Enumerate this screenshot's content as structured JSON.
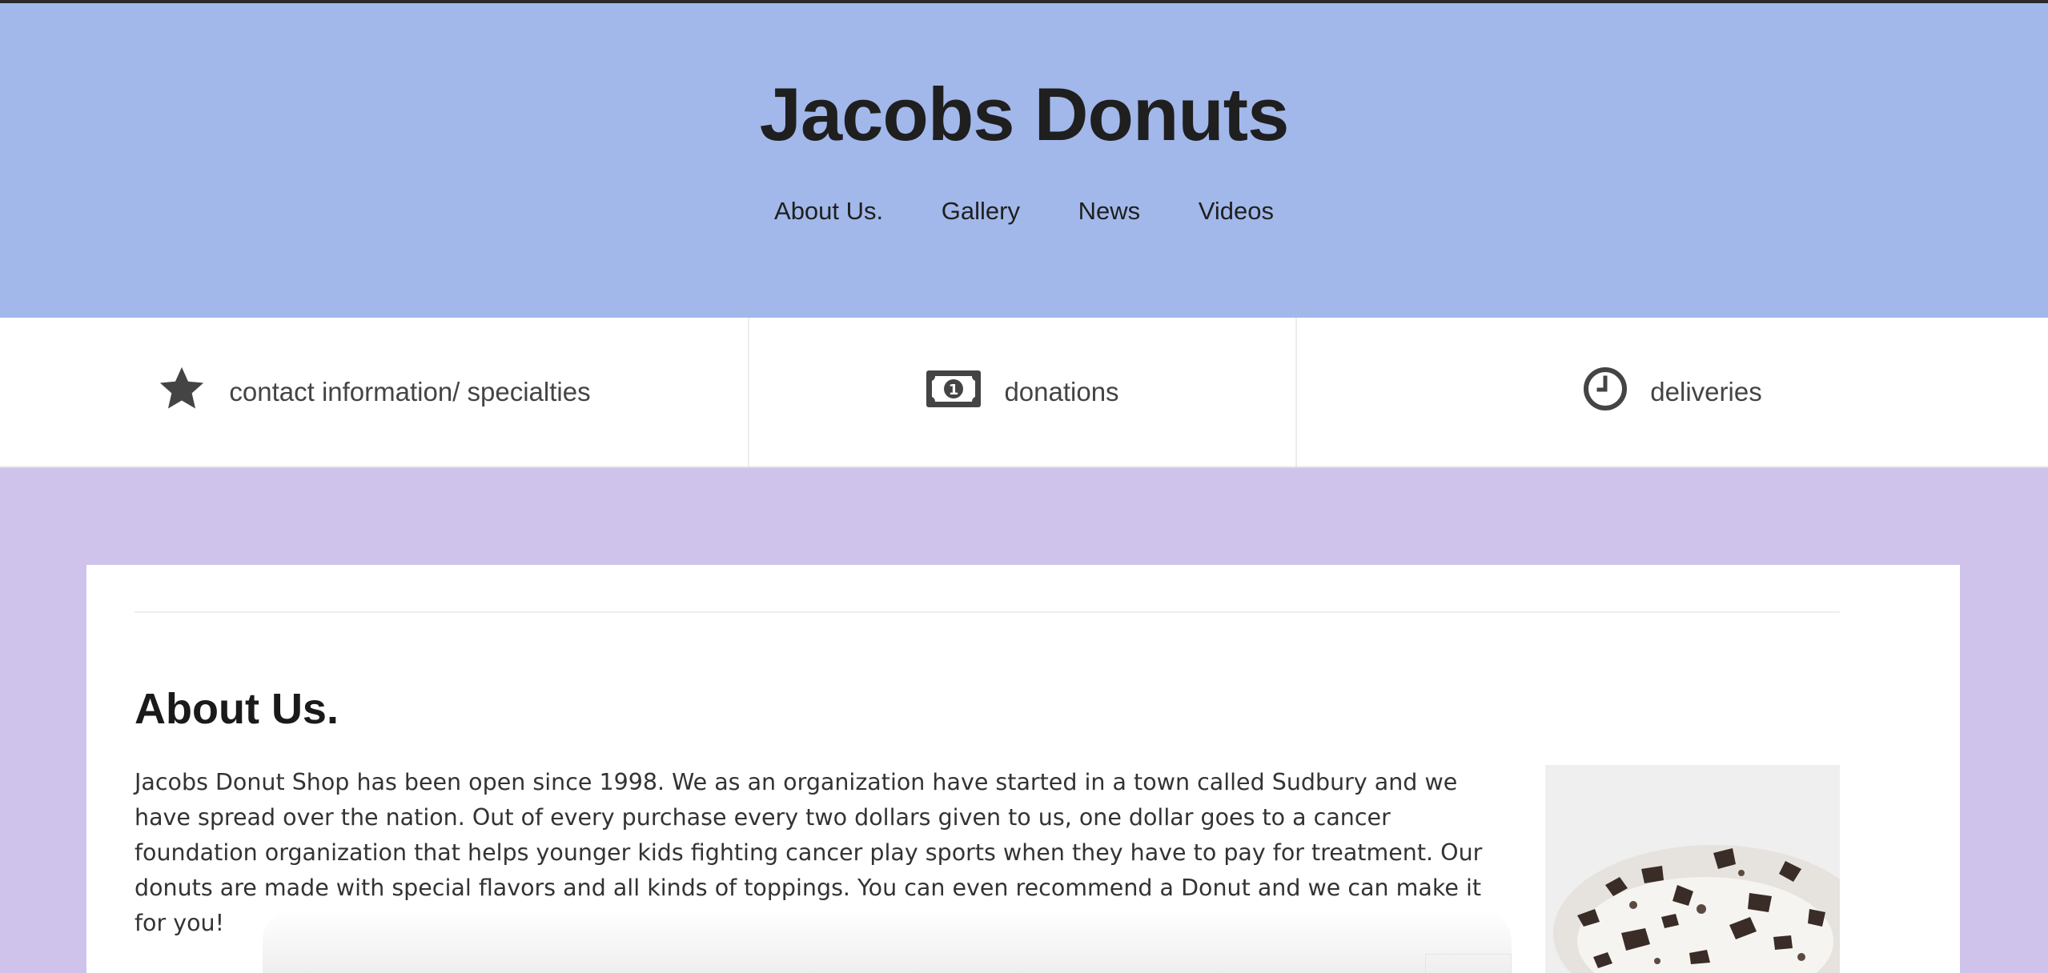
{
  "site": {
    "title": "Jacobs Donuts"
  },
  "nav": {
    "items": [
      "About Us.",
      "Gallery",
      "News",
      "Videos"
    ]
  },
  "features": [
    {
      "icon": "star-icon",
      "label": "contact information/ specialties"
    },
    {
      "icon": "money-bill-icon",
      "label": "donations"
    },
    {
      "icon": "clock-icon",
      "label": "deliveries"
    }
  ],
  "about": {
    "heading": "About Us.",
    "body": "Jacobs Donut Shop has been open since 1998. We as an organization have started in a town called Sudbury and we have spread over the nation. Out of every purchase every two dollars given to us, one dollar goes to a cancer foundation organization that helps younger kids fighting cancer play sports when they have to pay for treatment. Our donuts are made with special flavors and all kinds of toppings. You can even recommend a Donut and we can make it for you!",
    "image": "donut-photo"
  },
  "colors": {
    "header_bg": "#a2b8ea",
    "page_bg": "#cfc3ec",
    "icon": "#444444"
  }
}
